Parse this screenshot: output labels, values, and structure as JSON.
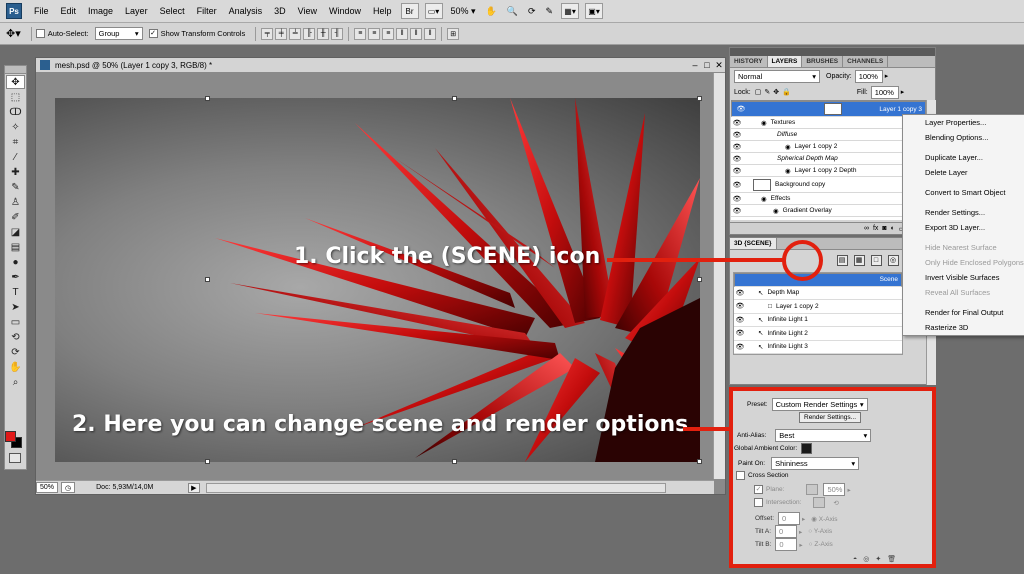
{
  "app_logo": "Ps",
  "menu": [
    "File",
    "Edit",
    "Image",
    "Layer",
    "Select",
    "Filter",
    "Analysis",
    "3D",
    "View",
    "Window",
    "Help"
  ],
  "menubar_tools": {
    "br": "Br",
    "zoom": "50%"
  },
  "options_bar": {
    "auto_select_label": "Auto-Select:",
    "auto_select_value": "Group",
    "show_transform_label": "Show Transform Controls"
  },
  "document": {
    "title": "mesh.psd @ 50% (Layer 1 copy 3, RGB/8) *",
    "zoom": "50%",
    "doc_size": "Doc: 5,93M/14,0M"
  },
  "layers_panel": {
    "tabs": [
      "HISTORY",
      "LAYERS",
      "BRUSHES",
      "CHANNELS"
    ],
    "active_tab": "LAYERS",
    "blend_mode": "Normal",
    "opacity_label": "Opacity:",
    "opacity_value": "100%",
    "lock_label": "Lock:",
    "fill_label": "Fill:",
    "fill_value": "100%",
    "layers": [
      {
        "name": "Layer 1 copy 3",
        "indent": 0,
        "selected": true,
        "thumb": true
      },
      {
        "name": "Textures",
        "indent": 1
      },
      {
        "name": "Diffuse",
        "indent": 2,
        "italic": true
      },
      {
        "name": "Layer 1 copy 2",
        "indent": 3
      },
      {
        "name": "Spherical Depth Map",
        "indent": 2,
        "italic": true
      },
      {
        "name": "Layer 1 copy 2 Depth",
        "indent": 3
      },
      {
        "name": "Background copy",
        "indent": 0,
        "thumb": true
      },
      {
        "name": "Effects",
        "indent": 1
      },
      {
        "name": "Gradient Overlay",
        "indent": 2
      }
    ]
  },
  "scene_panel": {
    "tab": "3D {SCENE}",
    "items": [
      {
        "name": "Scene",
        "indent": 0,
        "selected": true
      },
      {
        "name": "Depth Map",
        "indent": 1
      },
      {
        "name": "Layer 1 copy 2",
        "indent": 2
      },
      {
        "name": "Infinite Light 1",
        "indent": 1
      },
      {
        "name": "Infinite Light 2",
        "indent": 1
      },
      {
        "name": "Infinite Light 3",
        "indent": 1
      }
    ]
  },
  "render_settings": {
    "preset_label": "Preset:",
    "preset_value": "Custom Render Settings",
    "render_settings_button": "Render Settings...",
    "anti_alias_label": "Anti-Alias:",
    "anti_alias_value": "Best",
    "global_ambient_label": "Global Ambient Color:",
    "global_ambient_color": "#1a1a1a",
    "paint_on_label": "Paint On:",
    "paint_on_value": "Shininess",
    "cross_section_label": "Cross Section",
    "plane_label": "Plane:",
    "plane_value": "50%",
    "intersection_label": "Intersection:",
    "offset_label": "Offset:",
    "offset_value": "0",
    "tilt_a_label": "Tilt A:",
    "tilt_a_value": "0",
    "tilt_b_label": "Tilt B:",
    "tilt_b_value": "0",
    "x_axis": "X-Axis",
    "y_axis": "Y-Axis",
    "z_axis": "Z-Axis"
  },
  "context_menu": [
    {
      "label": "Layer Properties...",
      "enabled": true
    },
    {
      "label": "Blending Options...",
      "enabled": true
    },
    {
      "separator": true
    },
    {
      "label": "Duplicate Layer...",
      "enabled": true
    },
    {
      "label": "Delete Layer",
      "enabled": true
    },
    {
      "separator": true
    },
    {
      "label": "Convert to Smart Object",
      "enabled": true
    },
    {
      "separator": true
    },
    {
      "label": "Render Settings...",
      "enabled": true
    },
    {
      "label": "Export 3D Layer...",
      "enabled": true
    },
    {
      "separator": true
    },
    {
      "label": "Hide Nearest Surface",
      "enabled": false
    },
    {
      "label": "Only Hide Enclosed Polygons",
      "enabled": false
    },
    {
      "label": "Invert Visible Surfaces",
      "enabled": true
    },
    {
      "label": "Reveal All Surfaces",
      "enabled": false
    },
    {
      "separator": true
    },
    {
      "label": "Render for Final Output",
      "enabled": true
    },
    {
      "label": "Rasterize 3D",
      "enabled": true
    }
  ],
  "annotations": {
    "step1": "1. Click the (SCENE) icon",
    "step2": "2. Here you can change scene and render options",
    "accent_color": "#e2200e"
  }
}
